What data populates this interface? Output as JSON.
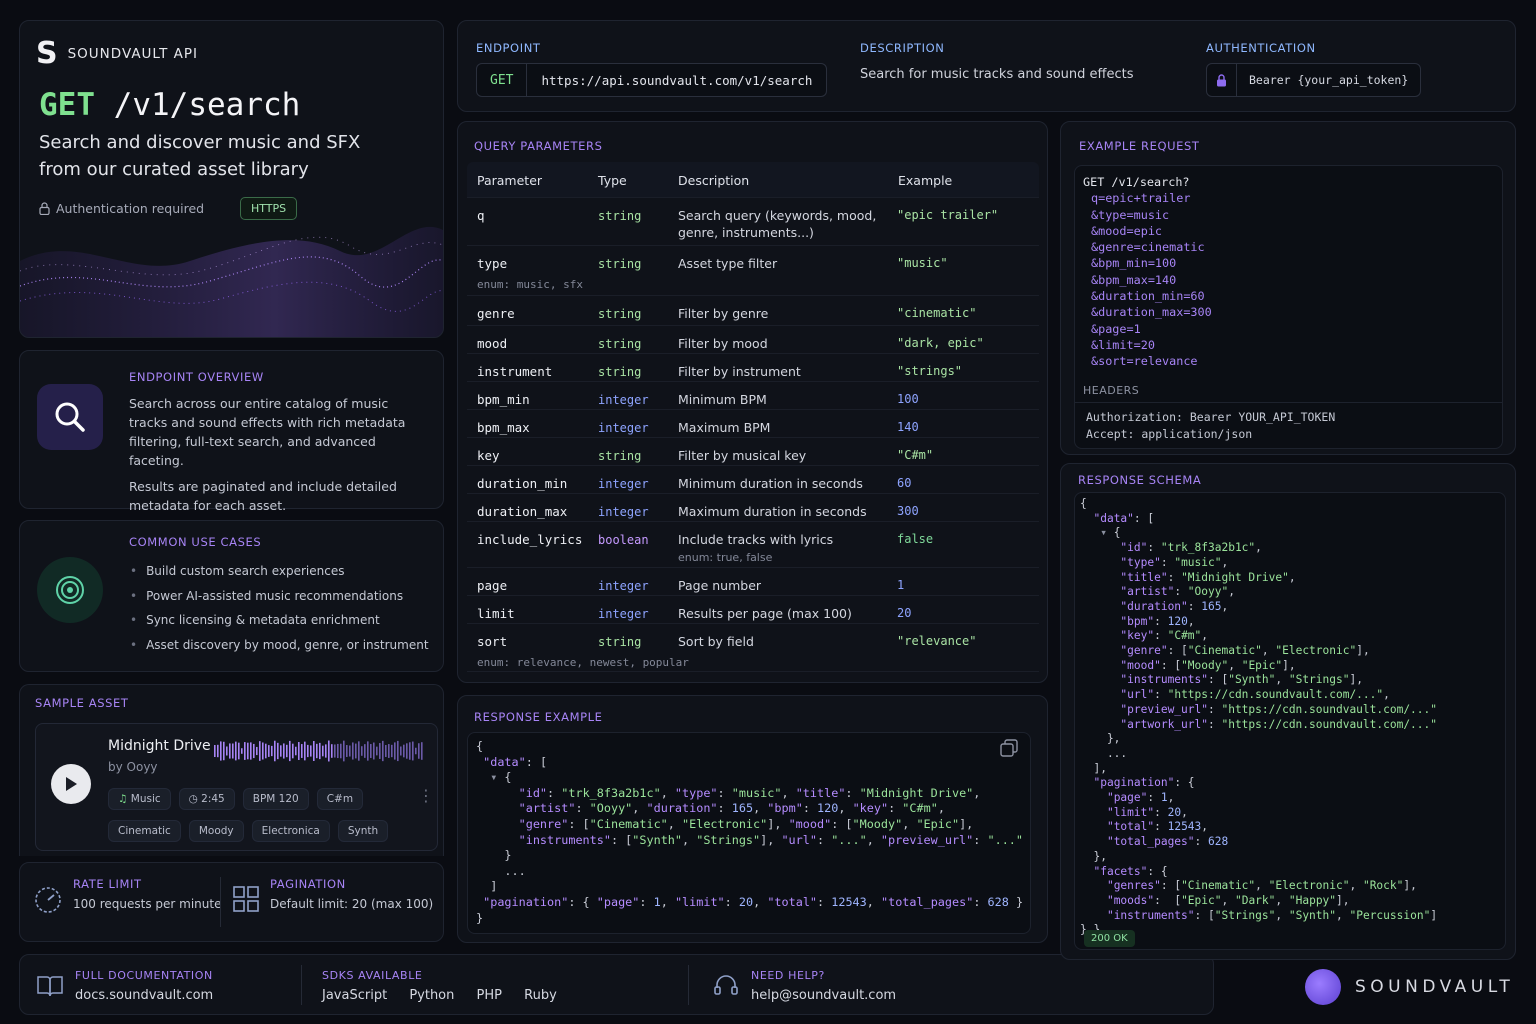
{
  "brand": {
    "name": "SOUNDVAULT API",
    "footer_word": "SOUNDVAULT"
  },
  "hero": {
    "method": "GET",
    "path": "/v1/search",
    "subtitle": "Search and discover music and SFX from our curated asset library",
    "auth_note": "Authentication required",
    "protocol": "HTTPS"
  },
  "overview": {
    "title": "ENDPOINT OVERVIEW",
    "para1": "Search across our entire catalog of music tracks and sound effects with rich metadata filtering, full-text search, and advanced faceting.",
    "para2": "Results are paginated and include detailed metadata for each asset."
  },
  "usecases": {
    "title": "COMMON USE CASES",
    "items": [
      "Build custom search experiences",
      "Power AI-assisted music recommendations",
      "Sync licensing & metadata enrichment",
      "Asset discovery by mood, genre, or instrument"
    ]
  },
  "sample": {
    "title": "SAMPLE ASSET",
    "track": "Midnight Drive",
    "artist": "by Ooyy",
    "meta": [
      "Music",
      "2:45",
      "BPM 120",
      "C#m"
    ],
    "tags": [
      "Cinematic",
      "Moody",
      "Electronica",
      "Synth"
    ]
  },
  "rate": {
    "title": "RATE LIMIT",
    "value": "100 requests per minute"
  },
  "pagination": {
    "title": "PAGINATION",
    "value": "Default limit: 20 (max 100)"
  },
  "footer": {
    "docs_title": "FULL DOCUMENTATION",
    "docs_value": "docs.soundvault.com",
    "sdk_title": "SDKS AVAILABLE",
    "sdks": [
      "JavaScript",
      "Python",
      "PHP",
      "Ruby"
    ],
    "help_title": "NEED HELP?",
    "help_value": "help@soundvault.com"
  },
  "endpoint": {
    "label": "ENDPOINT",
    "method": "GET",
    "url": "https://api.soundvault.com/v1/search",
    "desc_label": "DESCRIPTION",
    "desc": "Search for music tracks and sound effects",
    "auth_label": "AUTHENTICATION",
    "auth_value": "Bearer {your_api_token}"
  },
  "params": {
    "title": "QUERY PARAMETERS",
    "headers": [
      "Parameter",
      "Type",
      "Description",
      "Example"
    ],
    "rows": [
      {
        "name": "q",
        "type": "string",
        "desc": "Search query (keywords, mood,",
        "desc2": "genre, instruments...)",
        "example": "\"epic trailer\""
      },
      {
        "name": "type",
        "sub": "enum: music, sfx",
        "type": "string",
        "desc": "Asset type filter",
        "example": "\"music\""
      },
      {
        "name": "genre",
        "type": "string",
        "desc": "Filter by genre",
        "example": "\"cinematic\""
      },
      {
        "name": "mood",
        "type": "string",
        "desc": "Filter by mood",
        "example": "\"dark, epic\""
      },
      {
        "name": "instrument",
        "type": "string",
        "desc": "Filter by instrument",
        "example": "\"strings\""
      },
      {
        "name": "bpm_min",
        "type": "integer",
        "desc": "Minimum BPM",
        "example": "100"
      },
      {
        "name": "bpm_max",
        "type": "integer",
        "desc": "Maximum BPM",
        "example": "140"
      },
      {
        "name": "key",
        "type": "string",
        "desc": "Filter by musical key",
        "example": "\"C#m\""
      },
      {
        "name": "duration_min",
        "type": "integer",
        "desc": "Minimum duration in seconds",
        "example": "60"
      },
      {
        "name": "duration_max",
        "type": "integer",
        "desc": "Maximum duration in seconds",
        "example": "300"
      },
      {
        "name": "include_lyrics",
        "type": "boolean",
        "desc": "Include tracks with lyrics",
        "desc_sub": "enum: true, false",
        "example": "false"
      },
      {
        "name": "page",
        "type": "integer",
        "desc": "Page number",
        "example": "1"
      },
      {
        "name": "limit",
        "type": "integer",
        "desc": "Results per page (max 100)",
        "example": "20"
      },
      {
        "name": "sort",
        "sub": "enum: relevance, newest, popular",
        "type": "string",
        "desc": "Sort by field",
        "example": "\"relevance\""
      }
    ]
  },
  "response_example": {
    "title": "RESPONSE EXAMPLE"
  },
  "example_request": {
    "title": "EXAMPLE REQUEST",
    "first": "GET /v1/search?",
    "params": [
      "q=epic+trailer",
      "&type=music",
      "&mood=epic",
      "&genre=cinematic",
      "&bpm_min=100",
      "&bpm_max=140",
      "&duration_min=60",
      "&duration_max=300",
      "&page=1",
      "&limit=20",
      "&sort=relevance"
    ],
    "headers_title": "HEADERS",
    "headers": [
      "Authorization: Bearer YOUR_API_TOKEN",
      "Accept: application/json"
    ]
  },
  "schema": {
    "title": "RESPONSE SCHEMA",
    "status": "200 OK"
  }
}
